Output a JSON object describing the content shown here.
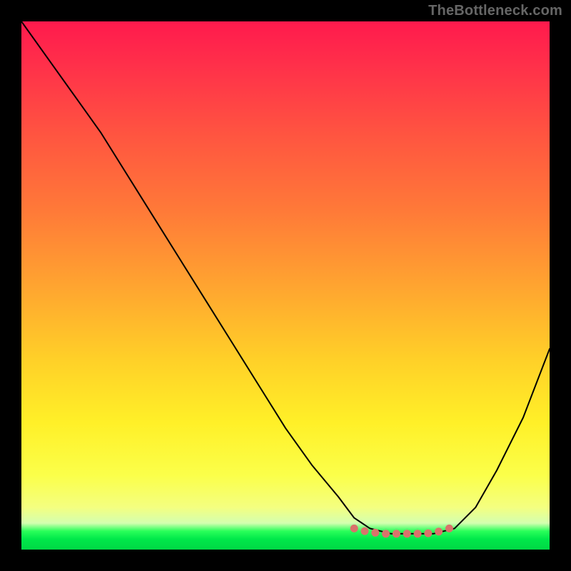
{
  "watermark": "TheBottleneck.com",
  "colors": {
    "gradient_top": "#ff1a4d",
    "gradient_mid_orange": "#ff7a38",
    "gradient_mid_yellow": "#fff028",
    "gradient_green": "#00e84a",
    "curve_stroke": "#000000",
    "marker_fill": "#d9736b",
    "frame_background": "#000000"
  },
  "chart_data": {
    "type": "line",
    "title": "",
    "xlabel": "",
    "ylabel": "",
    "xlim": [
      0,
      100
    ],
    "ylim": [
      0,
      100
    ],
    "grid": false,
    "legend": false,
    "series": [
      {
        "name": "bottleneck-curve",
        "x": [
          0,
          5,
          10,
          15,
          20,
          25,
          30,
          35,
          40,
          45,
          50,
          55,
          60,
          63,
          66,
          70,
          74,
          78,
          82,
          86,
          90,
          95,
          100
        ],
        "y": [
          100,
          93,
          86,
          79,
          71,
          63,
          55,
          47,
          39,
          31,
          23,
          16,
          10,
          6,
          4,
          3,
          3,
          3,
          4,
          8,
          15,
          25,
          38
        ]
      }
    ],
    "markers": {
      "name": "optimal-range-dots",
      "x": [
        63,
        65,
        67,
        69,
        71,
        73,
        75,
        77,
        79,
        81
      ],
      "y": [
        4.0,
        3.5,
        3.2,
        3.0,
        3.0,
        3.0,
        3.0,
        3.1,
        3.4,
        4.0
      ]
    },
    "background_bands": [
      {
        "name": "high-bottleneck",
        "color": "#ff1a4d",
        "y_from": 50,
        "y_to": 100
      },
      {
        "name": "medium-bottleneck",
        "color": "#ffd028",
        "y_from": 10,
        "y_to": 50
      },
      {
        "name": "low-bottleneck",
        "color": "#fbff4a",
        "y_from": 4,
        "y_to": 10
      },
      {
        "name": "optimal",
        "color": "#00e84a",
        "y_from": 0,
        "y_to": 4
      }
    ]
  }
}
